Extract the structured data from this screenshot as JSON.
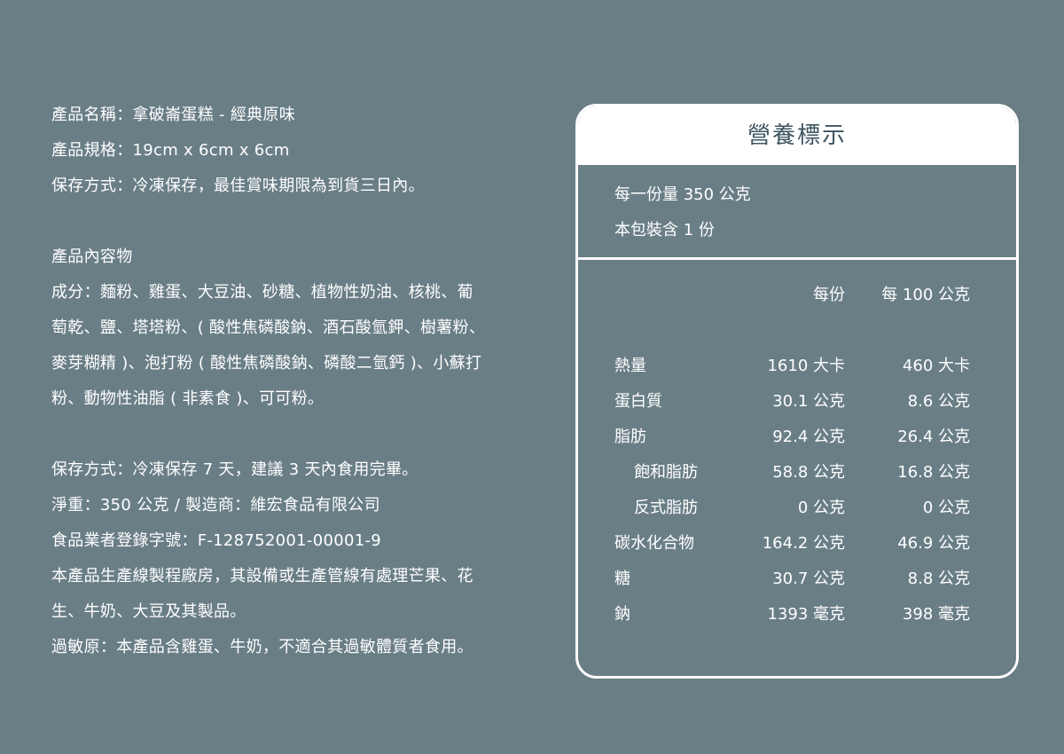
{
  "left": {
    "lines": [
      "產品名稱：拿破崙蛋糕 - 經典原味",
      "產品規格：19cm x 6cm x 6cm",
      "保存方式：冷凍保存，最佳賞味期限為到貨三日內。",
      "",
      "產品內容物",
      "成分：麵粉、雞蛋、大豆油、砂糖、植物性奶油、核桃、葡",
      "萄乾、鹽、塔塔粉、( 酸性焦磷酸鈉、酒石酸氫鉀、樹薯粉、",
      "麥芽糊精 )、泡打粉 ( 酸性焦磷酸鈉、磷酸二氫鈣 )、小蘇打",
      "粉、動物性油脂 ( 非素食 )、可可粉。",
      "",
      "保存方式：冷凍保存 7 天，建議 3 天內食用完畢。",
      "淨重：350 公克 / 製造商：維宏食品有限公司",
      "食品業者登錄字號：F-128752001-00001-9",
      "本產品生產線製程廠房，其設備或生產管線有處理芒果、花",
      "生、牛奶、大豆及其製品。",
      "過敏原：本產品含雞蛋、牛奶，不適合其過敏體質者食用。"
    ]
  },
  "nutrition": {
    "title": "營養標示",
    "serving_size": "每一份量 350 公克",
    "servings": "本包裝含 1 份",
    "col_per_serving": "每份",
    "col_per_100g": "每 100 公克",
    "rows": [
      {
        "label": "熱量",
        "per_serving": "1610 大卡",
        "per_100g": "460 大卡",
        "sub": false
      },
      {
        "label": "蛋白質",
        "per_serving": "30.1 公克",
        "per_100g": "8.6 公克",
        "sub": false
      },
      {
        "label": "脂肪",
        "per_serving": "92.4 公克",
        "per_100g": "26.4 公克",
        "sub": false
      },
      {
        "label": "飽和脂肪",
        "per_serving": "58.8 公克",
        "per_100g": "16.8 公克",
        "sub": true
      },
      {
        "label": "反式脂肪",
        "per_serving": "0 公克",
        "per_100g": "0 公克",
        "sub": true
      },
      {
        "label": "碳水化合物",
        "per_serving": "164.2 公克",
        "per_100g": "46.9 公克",
        "sub": false
      },
      {
        "label": "糖",
        "per_serving": "30.7 公克",
        "per_100g": "8.8 公克",
        "sub": false
      },
      {
        "label": "鈉",
        "per_serving": "1393 毫克",
        "per_100g": "398 毫克",
        "sub": false
      }
    ]
  }
}
